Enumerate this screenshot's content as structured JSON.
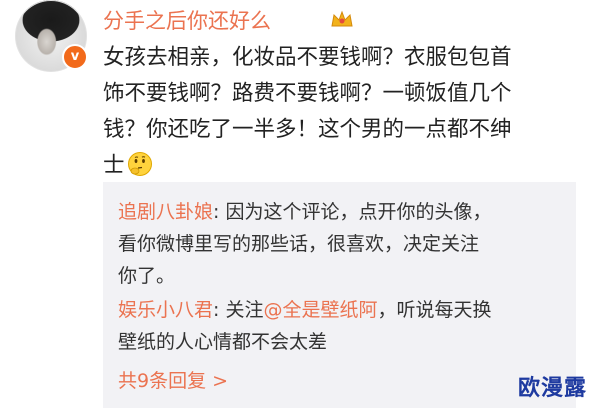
{
  "post": {
    "username": "分手之后你还好么",
    "body_lines": [
      "女孩去相亲，化妆品不要钱啊？衣服包包首",
      "饰不要钱啊？路费不要钱啊？一顿饭值几个",
      "钱？你还吃了一半多！这个男的一点都不绅",
      "士"
    ]
  },
  "icons": {
    "avatar": "avatar",
    "verify": "verified-v-icon",
    "crown": "crown-icon",
    "emoji": "thinking-emoji-icon"
  },
  "replies": [
    {
      "author": "追剧八卦娘",
      "separator": ": ",
      "text_lines": [
        "因为这个评论，点开你的头像，",
        "看你微博里写的那些话，很喜欢，决定关注",
        "你了。"
      ]
    },
    {
      "author": "娱乐小八君",
      "separator": ": ",
      "prefix": "关注",
      "mention": "@全是壁纸阿",
      "text_lines": [
        "，听说每天换",
        "壁纸的人心情都不会太差"
      ]
    }
  ],
  "more_replies": "共9条回复 >",
  "watermark": "欧漫露",
  "colors": {
    "username": "#eb7350",
    "reply_background": "#f2f2f5",
    "watermark": "#1e3aa0"
  }
}
